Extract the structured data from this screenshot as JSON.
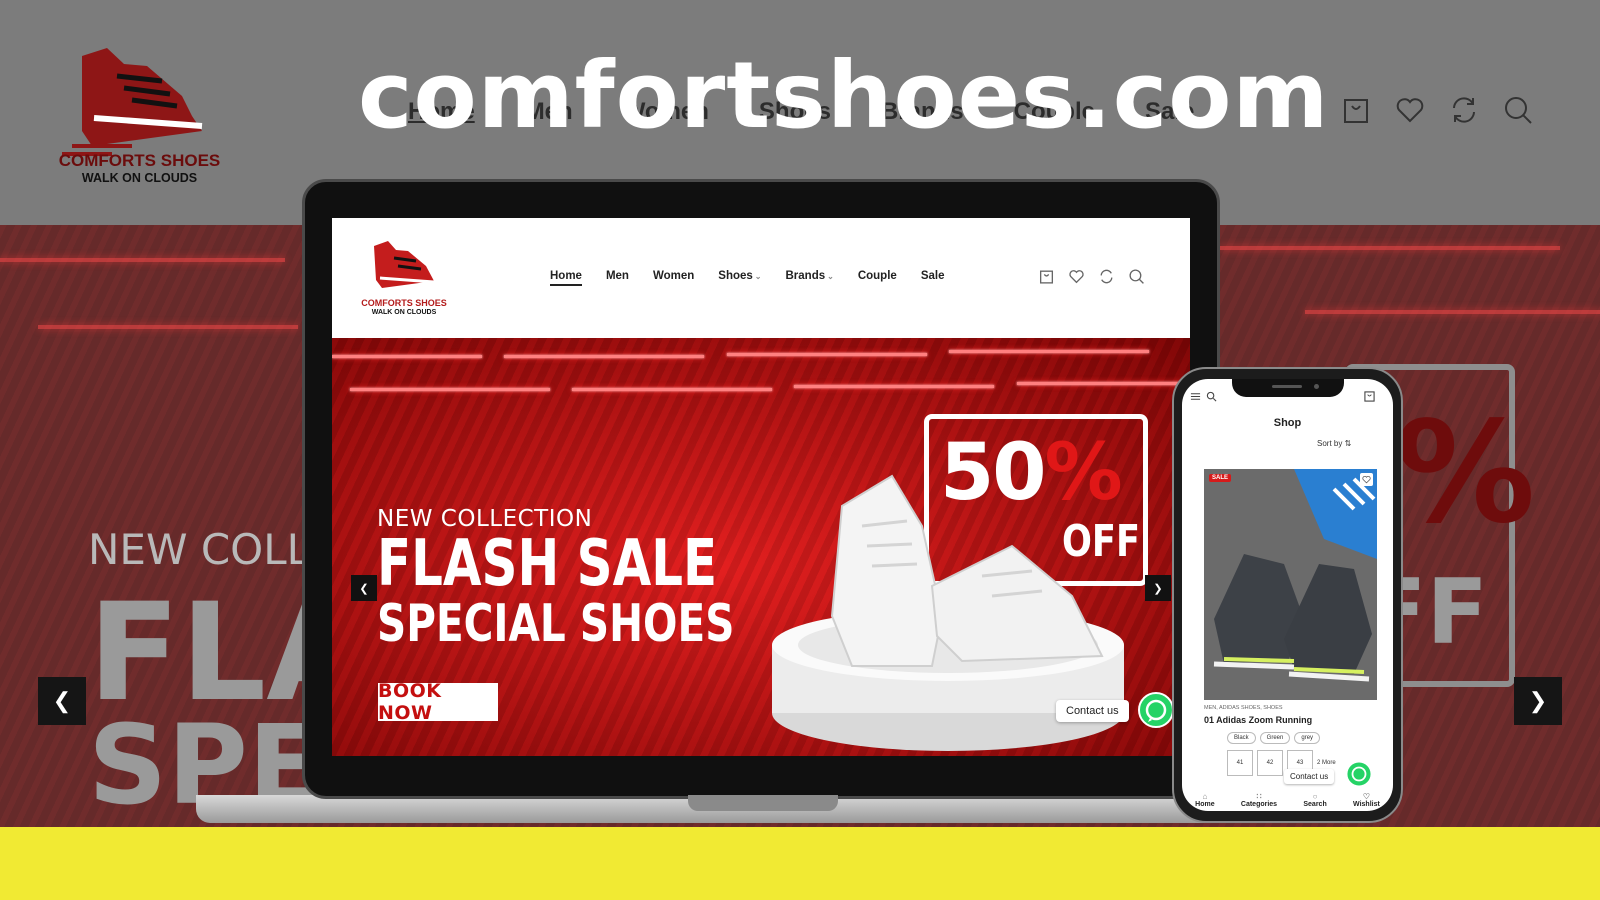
{
  "site": {
    "title": "comfortshoes.com"
  },
  "brand": {
    "name": "COMFORTS SHOES",
    "tagline": "WALK ON CLOUDS",
    "accent": "#b31b1b"
  },
  "background": {
    "nav": [
      "Home",
      "Men",
      "Women",
      "Shoes",
      "Brands",
      "Couple",
      "Sale"
    ],
    "hero": {
      "line1": "NEW COLL",
      "line2": "FLA",
      "line3": "SPEC",
      "badge_digit": "%",
      "badge_off": "FF"
    },
    "icons": [
      "cart-icon",
      "heart-icon",
      "compare-icon",
      "search-icon"
    ],
    "band_color": "#f1ea33"
  },
  "laptop": {
    "nav": [
      {
        "label": "Home"
      },
      {
        "label": "Men"
      },
      {
        "label": "Women"
      },
      {
        "label": "Shoes"
      },
      {
        "label": "Brands"
      },
      {
        "label": "Couple"
      },
      {
        "label": "Sale"
      }
    ],
    "hero": {
      "new_collection": "NEW COLLECTION",
      "title1": "FLASH SALE",
      "title2": "SPECIAL SHOES",
      "cta": "BOOK NOW",
      "discount": "50",
      "percent": "%",
      "off": "OFF"
    },
    "contact": "Contact us"
  },
  "phone": {
    "page_title": "Shop",
    "sort_label": "Sort by",
    "product": {
      "badge": "SALE",
      "category": "MEN, ADIDAS SHOES, SHOES",
      "name": "01 Adidas Zoom Running",
      "colors": [
        "Black",
        "Green",
        "grey"
      ],
      "sizes": [
        "41",
        "42",
        "43"
      ],
      "more": "2 More"
    },
    "contact": "Contact us",
    "bottom_nav": [
      "Home",
      "Categories",
      "Search",
      "Wishlist"
    ]
  }
}
